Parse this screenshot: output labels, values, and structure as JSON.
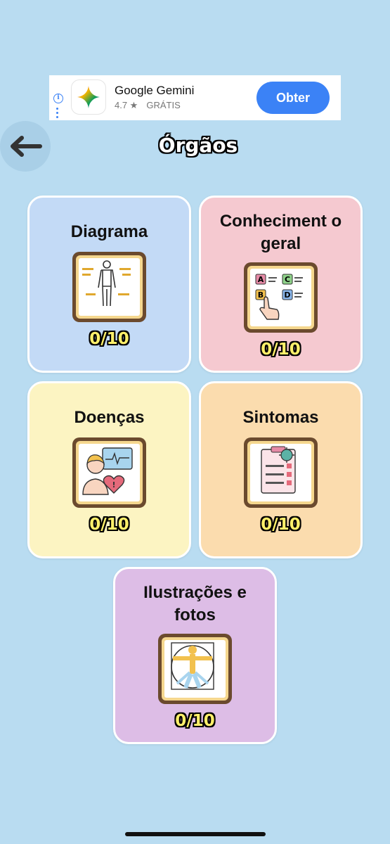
{
  "ad": {
    "app_name": "Google Gemini",
    "rating": "4.7 ★",
    "price": "GRÁTIS",
    "cta": "Obter",
    "logo_icon": "gemini-sparkle-icon",
    "info_icon": "info-icon"
  },
  "header": {
    "title": "Órgãos",
    "back_icon": "arrow-left-icon"
  },
  "cards": [
    {
      "label": "Diagrama",
      "score": "0/10",
      "icon": "human-body-diagram-icon",
      "color": "#c3daf6"
    },
    {
      "label": "Conheciment o geral",
      "score": "0/10",
      "icon": "multiple-choice-abcd-icon",
      "color": "#f5c9d0"
    },
    {
      "label": "Doenças",
      "score": "0/10",
      "icon": "patient-monitor-heart-icon",
      "color": "#fcf4c2"
    },
    {
      "label": "Sintomas",
      "score": "0/10",
      "icon": "symptom-checklist-icon",
      "color": "#fbdcae"
    },
    {
      "label": "Ilustrações e fotos",
      "score": "0/10",
      "icon": "vitruvian-man-icon",
      "color": "#ddbde6"
    }
  ],
  "colors": {
    "background": "#b9dcf1",
    "ad_button": "#3b82f6",
    "score_text": "#fff06a"
  }
}
